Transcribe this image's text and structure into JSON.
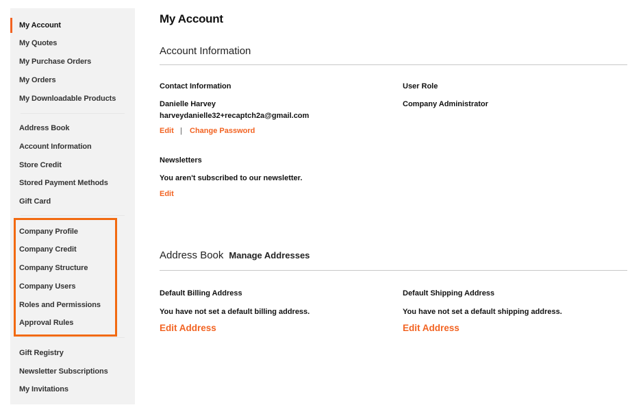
{
  "sidebar": {
    "accent_color": "#f26322",
    "group1": [
      "My Account",
      "My Quotes",
      "My Purchase Orders",
      "My Orders",
      "My Downloadable Products"
    ],
    "group2": [
      "Address Book",
      "Account Information",
      "Store Credit",
      "Stored Payment Methods",
      "Gift Card"
    ],
    "group3": [
      "Company Profile",
      "Company Credit",
      "Company Structure",
      "Company Users",
      "Roles and Permissions",
      "Approval Rules"
    ],
    "group4": [
      "Gift Registry",
      "Newsletter Subscriptions",
      "My Invitations"
    ],
    "active": "My Account",
    "highlight_color": "#f26a10"
  },
  "main": {
    "page_title": "My Account",
    "account_info": {
      "title": "Account Information",
      "contact": {
        "label": "Contact Information",
        "name": "Danielle Harvey",
        "email": "harveydanielle32+recaptch2a@gmail.com",
        "edit": "Edit",
        "separator": "|",
        "change_password": "Change Password"
      },
      "role": {
        "label": "User Role",
        "value": "Company Administrator"
      },
      "newsletters": {
        "label": "Newsletters",
        "value": "You aren't subscribed to our newsletter.",
        "edit": "Edit"
      }
    },
    "address_book": {
      "title": "Address Book",
      "manage": "Manage Addresses",
      "billing": {
        "label": "Default Billing Address",
        "value": "You have not set a default billing address.",
        "edit": "Edit Address"
      },
      "shipping": {
        "label": "Default Shipping Address",
        "value": "You have not set a default shipping address.",
        "edit": "Edit Address"
      }
    }
  }
}
